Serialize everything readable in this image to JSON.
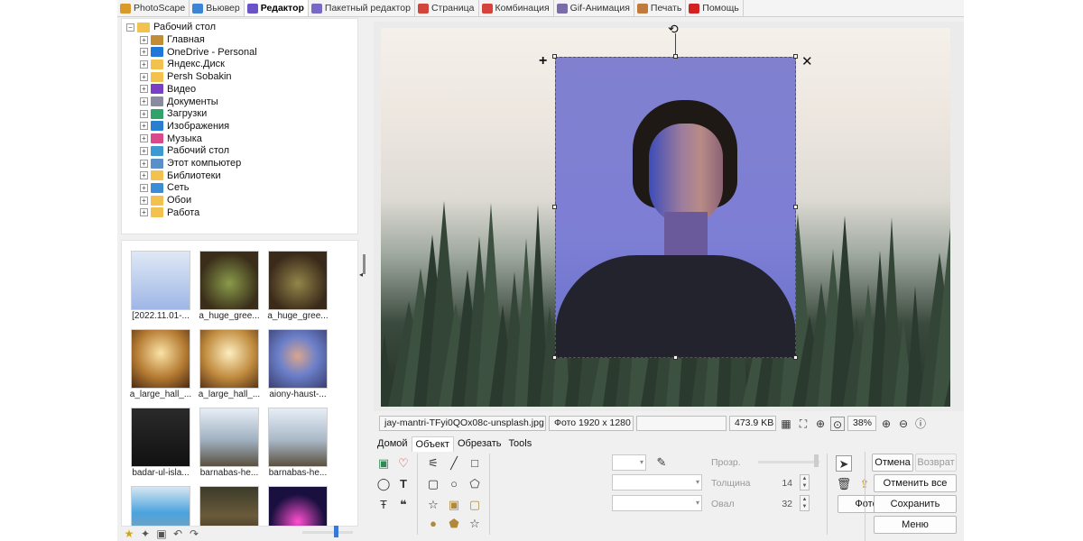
{
  "tabs": [
    {
      "label": "PhotoScape",
      "color": "#d99a2b",
      "active": false
    },
    {
      "label": "Вьювер",
      "color": "#3c84d6",
      "active": false
    },
    {
      "label": "Редактор",
      "color": "#6a54c8",
      "active": true
    },
    {
      "label": "Пакетный редактор",
      "color": "#7a68c6",
      "active": false
    },
    {
      "label": "Страница",
      "color": "#d2453b",
      "active": false
    },
    {
      "label": "Комбинация",
      "color": "#d6433a",
      "active": false
    },
    {
      "label": "Gif-Анимация",
      "color": "#7a6ca8",
      "active": false
    },
    {
      "label": "Печать",
      "color": "#c07a3c",
      "active": false
    },
    {
      "label": "Помощь",
      "color": "#d32020",
      "active": false
    }
  ],
  "tree": {
    "root": "Рабочий стол",
    "items": [
      {
        "label": "Главная",
        "icon": "home-icon",
        "color": "#c28d35"
      },
      {
        "label": "OneDrive - Personal",
        "icon": "cloud-icon",
        "color": "#1f77d8"
      },
      {
        "label": "Яндекс.Диск",
        "icon": "folder-icon",
        "color": "#f2c14e"
      },
      {
        "label": "Persh Sobakin",
        "icon": "folder-icon",
        "color": "#f2c14e"
      },
      {
        "label": "Видео",
        "icon": "video-icon",
        "color": "#7b3fc4"
      },
      {
        "label": "Документы",
        "icon": "document-icon",
        "color": "#8a8aa0"
      },
      {
        "label": "Загрузки",
        "icon": "download-icon",
        "color": "#2fa36a"
      },
      {
        "label": "Изображения",
        "icon": "image-icon",
        "color": "#2b7fd0"
      },
      {
        "label": "Музыка",
        "icon": "music-icon",
        "color": "#d94a8a"
      },
      {
        "label": "Рабочий стол",
        "icon": "desktop-icon",
        "color": "#3c9ad0"
      },
      {
        "label": "Этот компьютер",
        "icon": "computer-icon",
        "color": "#5a8fc8"
      },
      {
        "label": "Библиотеки",
        "icon": "folder-icon",
        "color": "#f2c14e"
      },
      {
        "label": "Сеть",
        "icon": "network-icon",
        "color": "#3b8ed6"
      },
      {
        "label": "Обои",
        "icon": "folder-icon",
        "color": "#f2c14e"
      },
      {
        "label": "Работа",
        "icon": "folder-icon",
        "color": "#f2c14e"
      }
    ]
  },
  "thumbnails": [
    {
      "caption": "[2022.11.01-...",
      "bg": "linear-gradient(180deg,#dfe8f5,#9fb6e6)"
    },
    {
      "caption": "a_huge_gree...",
      "bg": "radial-gradient(circle at 50% 55%,#8a9b4a,#3a2e1a 70%)"
    },
    {
      "caption": "a_huge_gree...",
      "bg": "radial-gradient(circle at 50% 55%,#93864a,#3a2a1a 70%)"
    },
    {
      "caption": "a_large_hall_...",
      "bg": "radial-gradient(circle at 50% 40%,#fbe3a6,#b47a32 55%,#4a2a12)"
    },
    {
      "caption": "a_large_hall_...",
      "bg": "radial-gradient(circle at 50% 40%,#fdeec0,#c08b3e 55%,#5a3416)"
    },
    {
      "caption": "aiony-haust-...",
      "bg": "radial-gradient(circle at 50% 45%,#d9a58f,#6c80c9 45%,#3a3f72)"
    },
    {
      "caption": "badar-ul-isla...",
      "bg": "linear-gradient(180deg,#2a2a2a,#111)"
    },
    {
      "caption": "barnabas-he...",
      "bg": "linear-gradient(180deg,#e7eef7,#9fb0c0 55%,#5a5040)"
    },
    {
      "caption": "barnabas-he...",
      "bg": "linear-gradient(180deg,#e7eef7,#a9b8c7 55%,#5a5040)"
    },
    {
      "caption": "",
      "bg": "linear-gradient(180deg,#d7e6f2,#4aa3dd 45%,#9aa4aa)"
    },
    {
      "caption": "",
      "bg": "linear-gradient(180deg,#3b3a2a,#6a5a3a 50%,#2a2a1a)"
    },
    {
      "caption": "",
      "bg": "radial-gradient(circle at 50% 60%,#ff4fd0,#1a1040 60%)"
    }
  ],
  "status": {
    "filename": "jay-mantri-TFyi0QOx08c-unsplash.jpg",
    "photo_info": "Фото 1920 x 1280",
    "filesize": "473.9 KB",
    "zoom": "38%"
  },
  "bottom_tabs": [
    {
      "label": "Домой",
      "active": false
    },
    {
      "label": "Объект",
      "active": true
    },
    {
      "label": "Обрезать",
      "active": false
    },
    {
      "label": "Tools",
      "active": false
    }
  ],
  "props": {
    "opacity_label": "Прозр.",
    "thickness_label": "Толщина",
    "thickness_value": "14",
    "oval_label": "Овал",
    "oval_value": "32"
  },
  "actions": {
    "photo_object": "Фото+Объект",
    "undo": "Отмена",
    "redo": "Возврат",
    "undo_all": "Отменить все",
    "save": "Сохранить",
    "menu": "Меню"
  }
}
